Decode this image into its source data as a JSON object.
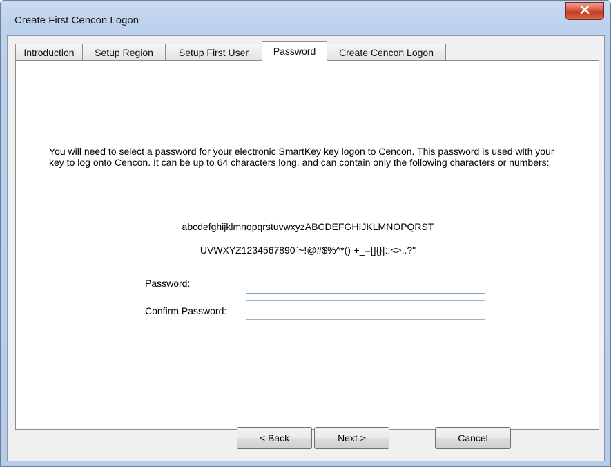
{
  "window": {
    "title": "Create First Cencon Logon",
    "close_glyph": "✕"
  },
  "tabs": [
    {
      "label": "Introduction",
      "active": false
    },
    {
      "label": "Setup Region",
      "active": false
    },
    {
      "label": "Setup First User",
      "active": false
    },
    {
      "label": "Password",
      "active": true
    },
    {
      "label": "Create Cencon Logon",
      "active": false
    }
  ],
  "content": {
    "instructions": "You will need to select a password for your electronic SmartKey key logon to Cencon.  This password is used with your key to log onto Cencon.  It can be up to 64 characters long, and can contain only the following characters or numbers:",
    "allowed_chars_line1": "abcdefghijklmnopqrstuvwxyzABCDEFGHIJKLMNOPQRST",
    "allowed_chars_line2": "UVWXYZ1234567890`~!@#$%^*()-+_=[]{}|:;<>,.?\""
  },
  "form": {
    "password_label": "Password:",
    "password_value": "",
    "confirm_label": "Confirm Password:",
    "confirm_value": ""
  },
  "buttons": {
    "back": "< Back",
    "next": "Next >",
    "cancel": "Cancel"
  },
  "colors": {
    "frame": "#bcd1ec",
    "close": "#c23b22",
    "focus_border": "#7da2ce"
  },
  "icons": {
    "close": "close-icon"
  }
}
